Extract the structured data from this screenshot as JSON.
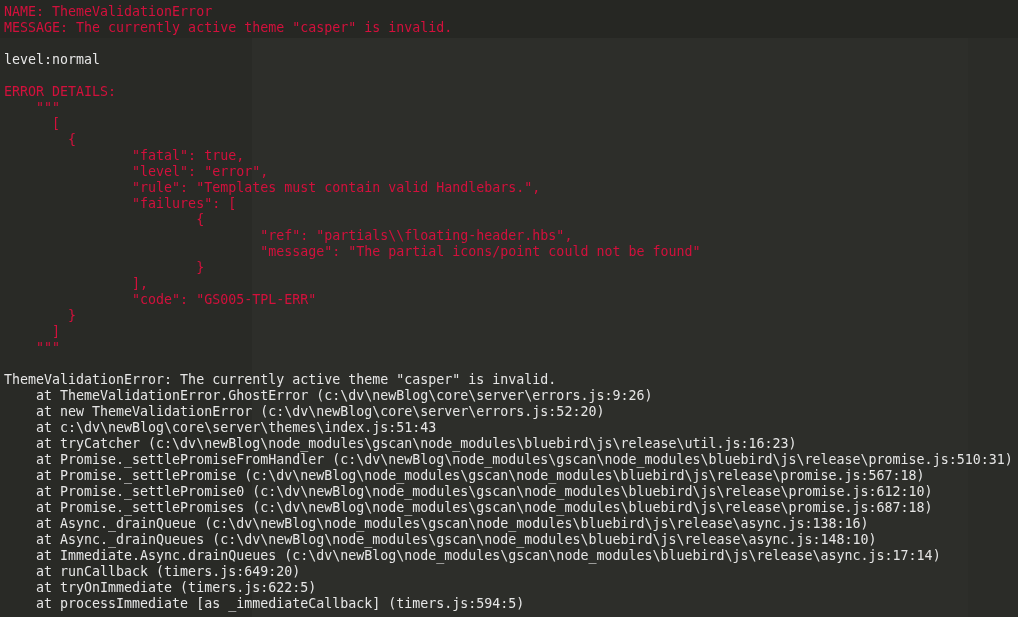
{
  "lines": [
    {
      "kind": "error",
      "text": "NAME: ThemeValidationError"
    },
    {
      "kind": "error",
      "text": "MESSAGE: The currently active theme \"casper\" is invalid."
    },
    {
      "kind": "blank"
    },
    {
      "kind": "normal",
      "text": "level:normal"
    },
    {
      "kind": "blank"
    },
    {
      "kind": "error",
      "text": "ERROR DETAILS:"
    },
    {
      "kind": "error",
      "text": "    \"\"\""
    },
    {
      "kind": "error",
      "text": "      ["
    },
    {
      "kind": "error",
      "text": "        {"
    },
    {
      "kind": "error",
      "text": "                \"fatal\": true,"
    },
    {
      "kind": "error",
      "text": "                \"level\": \"error\","
    },
    {
      "kind": "error",
      "text": "                \"rule\": \"Templates must contain valid Handlebars.\","
    },
    {
      "kind": "error",
      "text": "                \"failures\": ["
    },
    {
      "kind": "error",
      "text": "                        {"
    },
    {
      "kind": "error",
      "text": "                                \"ref\": \"partials\\\\floating-header.hbs\","
    },
    {
      "kind": "error",
      "text": "                                \"message\": \"The partial icons/point could not be found\""
    },
    {
      "kind": "error",
      "text": "                        }"
    },
    {
      "kind": "error",
      "text": "                ],"
    },
    {
      "kind": "error",
      "text": "                \"code\": \"GS005-TPL-ERR\""
    },
    {
      "kind": "error",
      "text": "        }"
    },
    {
      "kind": "error",
      "text": "      ]"
    },
    {
      "kind": "error",
      "text": "    \"\"\""
    },
    {
      "kind": "blank"
    },
    {
      "kind": "normal",
      "text": "ThemeValidationError: The currently active theme \"casper\" is invalid."
    },
    {
      "kind": "normal",
      "text": "    at ThemeValidationError.GhostError (c:\\dv\\newBlog\\core\\server\\errors.js:9:26)"
    },
    {
      "kind": "normal",
      "text": "    at new ThemeValidationError (c:\\dv\\newBlog\\core\\server\\errors.js:52:20)"
    },
    {
      "kind": "normal",
      "text": "    at c:\\dv\\newBlog\\core\\server\\themes\\index.js:51:43"
    },
    {
      "kind": "normal",
      "text": "    at tryCatcher (c:\\dv\\newBlog\\node_modules\\gscan\\node_modules\\bluebird\\js\\release\\util.js:16:23)"
    },
    {
      "kind": "normal",
      "text": "    at Promise._settlePromiseFromHandler (c:\\dv\\newBlog\\node_modules\\gscan\\node_modules\\bluebird\\js\\release\\promise.js:510:31)"
    },
    {
      "kind": "normal",
      "text": "    at Promise._settlePromise (c:\\dv\\newBlog\\node_modules\\gscan\\node_modules\\bluebird\\js\\release\\promise.js:567:18)"
    },
    {
      "kind": "normal",
      "text": "    at Promise._settlePromise0 (c:\\dv\\newBlog\\node_modules\\gscan\\node_modules\\bluebird\\js\\release\\promise.js:612:10)"
    },
    {
      "kind": "normal",
      "text": "    at Promise._settlePromises (c:\\dv\\newBlog\\node_modules\\gscan\\node_modules\\bluebird\\js\\release\\promise.js:687:18)"
    },
    {
      "kind": "normal",
      "text": "    at Async._drainQueue (c:\\dv\\newBlog\\node_modules\\gscan\\node_modules\\bluebird\\js\\release\\async.js:138:16)"
    },
    {
      "kind": "normal",
      "text": "    at Async._drainQueues (c:\\dv\\newBlog\\node_modules\\gscan\\node_modules\\bluebird\\js\\release\\async.js:148:10)"
    },
    {
      "kind": "normal",
      "text": "    at Immediate.Async.drainQueues (c:\\dv\\newBlog\\node_modules\\gscan\\node_modules\\bluebird\\js\\release\\async.js:17:14)"
    },
    {
      "kind": "normal",
      "text": "    at runCallback (timers.js:649:20)"
    },
    {
      "kind": "normal",
      "text": "    at tryOnImmediate (timers.js:622:5)"
    },
    {
      "kind": "normal",
      "text": "    at processImmediate [as _immediateCallback] (timers.js:594:5)"
    }
  ]
}
